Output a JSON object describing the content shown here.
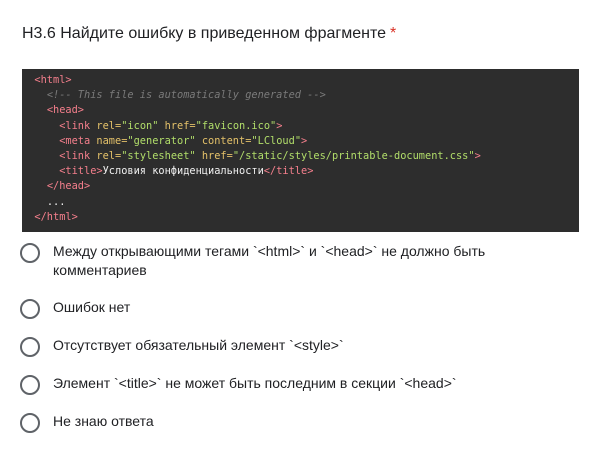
{
  "question": {
    "title": "Н3.6 Найдите ошибку в приведенном фрагменте",
    "required_mark": "*"
  },
  "code": {
    "lines": [
      {
        "indent": "  ",
        "parts": [
          [
            "t",
            "<html>"
          ]
        ]
      },
      {
        "indent": "    ",
        "parts": [
          [
            "c",
            "<!-- This file is automatically generated -->"
          ]
        ]
      },
      {
        "indent": "    ",
        "parts": [
          [
            "t",
            "<head>"
          ]
        ]
      },
      {
        "indent": "      ",
        "parts": [
          [
            "p",
            "<"
          ],
          [
            "t",
            "link "
          ],
          [
            "a",
            "rel="
          ],
          [
            "v",
            "\"icon\" "
          ],
          [
            "a",
            "href="
          ],
          [
            "v",
            "\"favicon.ico\""
          ],
          [
            "p",
            ">"
          ]
        ]
      },
      {
        "indent": "      ",
        "parts": [
          [
            "p",
            "<"
          ],
          [
            "t",
            "meta "
          ],
          [
            "a",
            "name="
          ],
          [
            "v",
            "\"generator\" "
          ],
          [
            "a",
            "content="
          ],
          [
            "v",
            "\"LCloud\""
          ],
          [
            "p",
            ">"
          ]
        ]
      },
      {
        "indent": "      ",
        "parts": [
          [
            "p",
            "<"
          ],
          [
            "t",
            "link "
          ],
          [
            "a",
            "rel="
          ],
          [
            "v",
            "\"stylesheet\" "
          ],
          [
            "a",
            "href="
          ],
          [
            "v",
            "\"/static/styles/printable-document.css\""
          ],
          [
            "p",
            ">"
          ]
        ]
      },
      {
        "indent": "      ",
        "parts": [
          [
            "t",
            "<title>"
          ],
          [
            "txt",
            "Условия конфиденциальности"
          ],
          [
            "t",
            "</title>"
          ]
        ]
      },
      {
        "indent": "    ",
        "parts": [
          [
            "t",
            "</head>"
          ]
        ]
      },
      {
        "indent": "    ",
        "parts": [
          [
            "txt",
            "..."
          ]
        ]
      },
      {
        "indent": "  ",
        "parts": [
          [
            "t",
            "</html>"
          ]
        ]
      }
    ]
  },
  "options": [
    {
      "label": "Между открывающими тегами `<html>` и `<head>` не должно быть комментариев"
    },
    {
      "label": "Ошибок нет"
    },
    {
      "label": "Отсутствует обязательный элемент `<style>`"
    },
    {
      "label": "Элемент `<title>` не может быть последним в секции `<head>`"
    },
    {
      "label": "Не знаю ответа"
    }
  ]
}
